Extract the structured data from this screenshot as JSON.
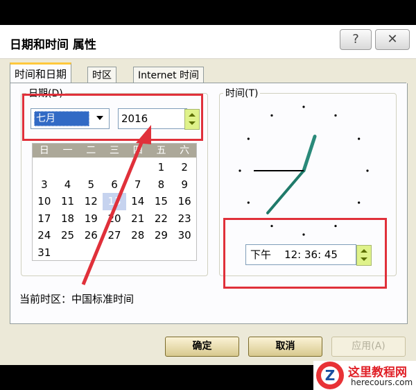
{
  "window": {
    "title": "日期和时间 属性",
    "help_button": "?",
    "close_button": "✕"
  },
  "tabs": [
    {
      "label": "时间和日期",
      "active": true
    },
    {
      "label": "时区",
      "active": false
    },
    {
      "label": "Internet 时间",
      "active": false
    }
  ],
  "date_group": {
    "label": "日期(D)",
    "month_value": "七月",
    "year_value": "2016"
  },
  "calendar": {
    "weekdays": [
      "日",
      "一",
      "二",
      "三",
      "四",
      "五",
      "六"
    ],
    "weeks": [
      [
        "",
        "",
        "",
        "",
        "",
        "1",
        "2"
      ],
      [
        "3",
        "4",
        "5",
        "6",
        "7",
        "8",
        "9"
      ],
      [
        "10",
        "11",
        "12",
        "13",
        "14",
        "15",
        "16"
      ],
      [
        "17",
        "18",
        "19",
        "20",
        "21",
        "22",
        "23"
      ],
      [
        "24",
        "25",
        "26",
        "27",
        "28",
        "29",
        "30"
      ],
      [
        "31",
        "",
        "",
        "",
        "",
        "",
        ""
      ]
    ],
    "selected_day": "13"
  },
  "timezone_text": "当前时区：中国标准时间",
  "time_group": {
    "label": "时间(T)",
    "time_value": "下午    12: 36: 45"
  },
  "clock": {
    "hour": 12,
    "minute": 36,
    "second": 45
  },
  "buttons": {
    "ok": "确定",
    "cancel": "取消",
    "apply": "应用(A)"
  },
  "watermark": {
    "title": "这里教程网",
    "site": "herecours.com",
    "logo_letter": "Z"
  },
  "colors": {
    "highlight_box": "#e0303a",
    "selection": "#316ac5",
    "spinner": "#dff28a"
  }
}
